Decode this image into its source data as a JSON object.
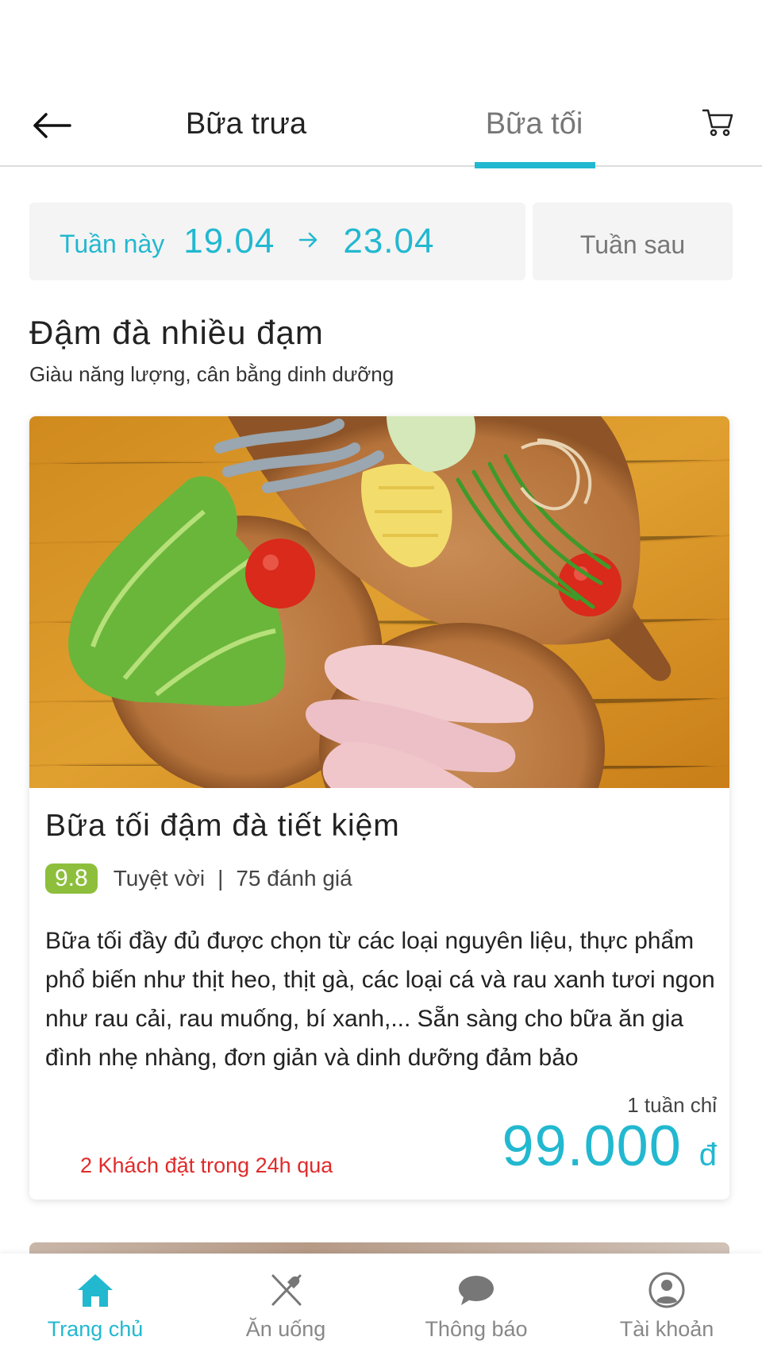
{
  "header": {
    "back_icon": "arrow-left-icon",
    "tabs": [
      {
        "label": "Bữa trưa",
        "active": false
      },
      {
        "label": "Bữa tối",
        "active": true
      }
    ],
    "cart_icon": "cart-icon",
    "accent_color": "#22b8d0"
  },
  "week": {
    "label": "Tuần này",
    "start": "19.04",
    "end": "23.04",
    "next_label": "Tuần sau"
  },
  "section": {
    "title": "Đậm đà nhiều đạm",
    "subtitle": "Giàu năng lượng, cân bằng dinh dưỡng"
  },
  "card": {
    "title": "Bữa tối đậm đà tiết kiệm",
    "rating_score": "9.8",
    "rating_text": "Tuyệt vời",
    "rating_separator": "|",
    "review_count": "75 đánh giá",
    "description": "Bữa tối đầy đủ được chọn từ các loại nguyên liệu, thực phẩm phổ biến như thịt heo, thịt gà, các loại cá và rau xanh tươi ngon như rau cải, rau muống, bí xanh,... Sẵn sàng cho bữa ăn gia đình nhẹ nhàng, đơn giản và dinh dưỡng đảm bảo",
    "price_prefix": "1 tuần chỉ",
    "price": "99.000",
    "currency": "đ",
    "orders_note": "2 Khách đặt trong 24h qua"
  },
  "bottom_nav": [
    {
      "label": "Trang chủ",
      "icon": "home-icon",
      "active": true
    },
    {
      "label": "Ăn uống",
      "icon": "utensils-icon",
      "active": false
    },
    {
      "label": "Thông báo",
      "icon": "chat-bubble-icon",
      "active": false
    },
    {
      "label": "Tài khoản",
      "icon": "user-icon",
      "active": false
    }
  ]
}
